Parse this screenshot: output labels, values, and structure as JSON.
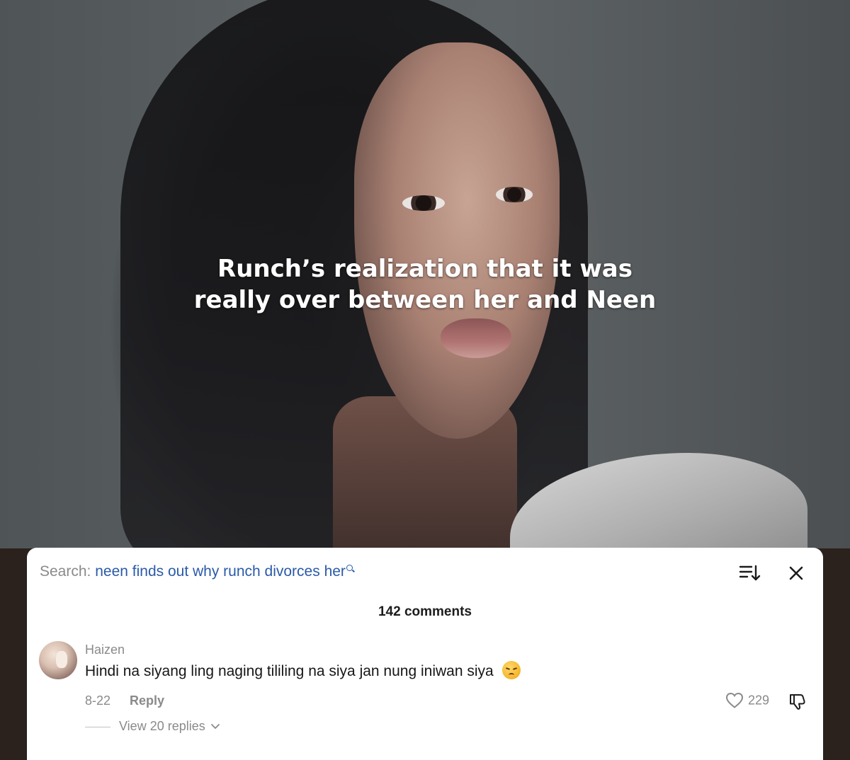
{
  "video": {
    "caption_line1": "Runch’s realization that it was",
    "caption_line2": "really over between her and Neen"
  },
  "search": {
    "label": "Search: ",
    "query": "neen finds out why runch divorces her",
    "icon": "search-icon"
  },
  "header": {
    "sort_icon": "sort-icon",
    "close_icon": "close-icon"
  },
  "comments": {
    "count_label": "142 comments",
    "items": [
      {
        "username": "Haizen",
        "text": "Hindi na siyang ling naging tililing na siya jan nung iniwan siya",
        "emoji": "disappointed-face",
        "date": "8-22",
        "reply_label": "Reply",
        "likes": "229",
        "view_replies_label": "View 20 replies"
      }
    ]
  },
  "colors": {
    "link_blue": "#2b5aa8",
    "muted_gray": "#8a8a8a",
    "sheet_bg": "#ffffff",
    "page_bg": "#2b211d"
  }
}
